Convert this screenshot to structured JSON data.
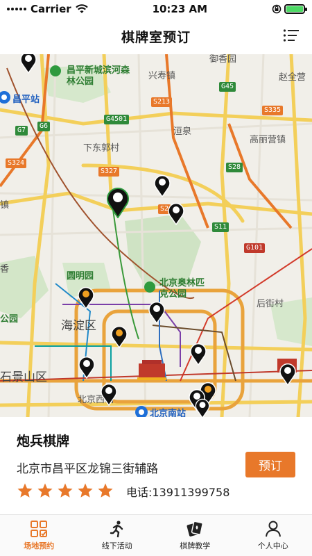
{
  "status_bar": {
    "carrier": "Carrier",
    "time": "10:23 AM"
  },
  "header": {
    "title": "棋牌室预订",
    "menu_icon": "list-menu-icon"
  },
  "map": {
    "labels": {
      "yuxiang": "御香园",
      "changping_park": "昌平新城滨河森林公园",
      "xingshou": "兴寿镇",
      "zhaoquanying": "赵全营",
      "changping_station": "昌平站",
      "xiadaguocun": "下东郭村",
      "zhuang": "洹泉",
      "gaoliying": "高丽营镇",
      "zhen": "镇",
      "yuanmingyuan": "圆明园",
      "olympic_park": "北京奥林匹克公园",
      "houjiecun": "后街村",
      "xiang": "香",
      "haidian": "海淀区",
      "park": "公园",
      "shijingshan": "石景山区",
      "beijing_west": "北京西站",
      "beijing_south": "北京南站"
    },
    "shields": {
      "g45": "G45",
      "s213": "S213",
      "s335": "S335",
      "g7": "G7",
      "g6": "G6",
      "g4501": "G4501",
      "s324": "S324",
      "s327": "S327",
      "s28": "S28",
      "s11": "S11",
      "g101": "G101",
      "s2": "S2"
    }
  },
  "venue": {
    "name": "炮兵棋牌",
    "address": "北京市昌平区龙锦三街辅路",
    "book_label": "预订",
    "rating": 5,
    "phone": "电话:13911399758"
  },
  "tabs": [
    {
      "label": "场地预约",
      "icon": "venue-grid-icon",
      "active": true
    },
    {
      "label": "线下活动",
      "icon": "running-person-icon",
      "active": false
    },
    {
      "label": "棋牌教学",
      "icon": "playing-cards-icon",
      "active": false
    },
    {
      "label": "个人中心",
      "icon": "user-profile-icon",
      "active": false
    }
  ],
  "colors": {
    "accent": "#e8782a",
    "pin": "#111111",
    "pin_ring": "#f0a020"
  }
}
